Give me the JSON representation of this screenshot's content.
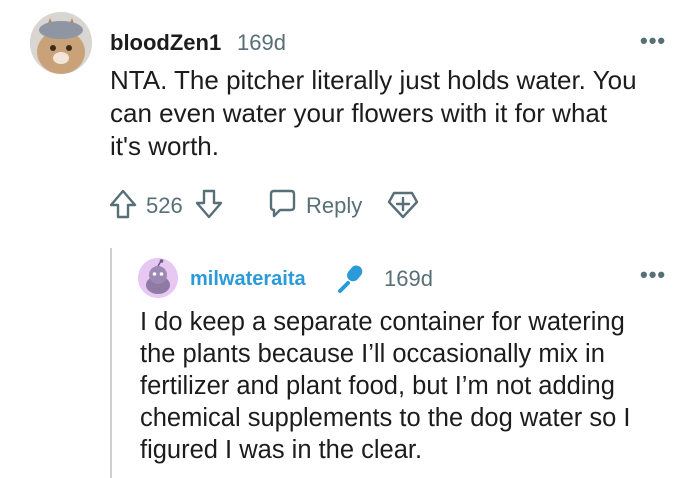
{
  "comment": {
    "username": "bloodZen1",
    "age": "169d",
    "more": "•••",
    "text_lines": [
      "NTA. The pitcher literally just holds water. You",
      "can even water your flowers with it for what",
      "it's worth."
    ],
    "votes": "526",
    "reply_label": "Reply"
  },
  "reply": {
    "username": "milwateraita",
    "age": "169d",
    "more": "•••",
    "text_lines": [
      "I do keep a separate container for watering",
      "the plants because I’ll occasionally mix in",
      "fertilizer and plant food, but I’m not adding",
      "chemical supplements to the dog water so I",
      "figured I was in the clear."
    ]
  },
  "colors": {
    "accent_blue": "#2a9bd8",
    "meta_gray": "#576f76"
  }
}
